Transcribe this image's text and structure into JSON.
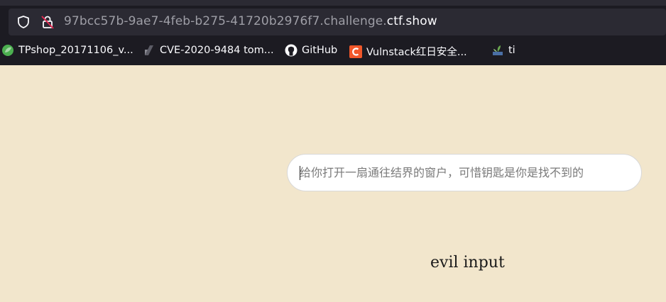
{
  "browser": {
    "url_host_prefix": "97bcc57b-9ae7-4feb-b275-41720b2976f7.challenge.",
    "url_host_domain": "ctf.show",
    "icons": [
      "shield-icon",
      "insecure-lock-icon"
    ]
  },
  "bookmarks": [
    {
      "label": "TPshop_20171106_v...",
      "icon": "green-circle-icon",
      "color": "#4caf50"
    },
    {
      "label": "CVE-2020-9484 tom...",
      "icon": "page-icon",
      "color": "#8a8a93"
    },
    {
      "label": "GitHub",
      "icon": "github-icon",
      "color": "#ffffff"
    },
    {
      "label": "Vulnstack红日安全...",
      "icon": "c-logo-icon",
      "color": "#f0572a"
    },
    {
      "label": "ti",
      "icon": "plant-icon",
      "color": "#6aa84f"
    }
  ],
  "search": {
    "placeholder": "给你打开一扇通往结界的窗户，可惜钥匙是你是找不到的",
    "value": ""
  },
  "page": {
    "caption": "evil input",
    "background": "#f2e6cc"
  }
}
